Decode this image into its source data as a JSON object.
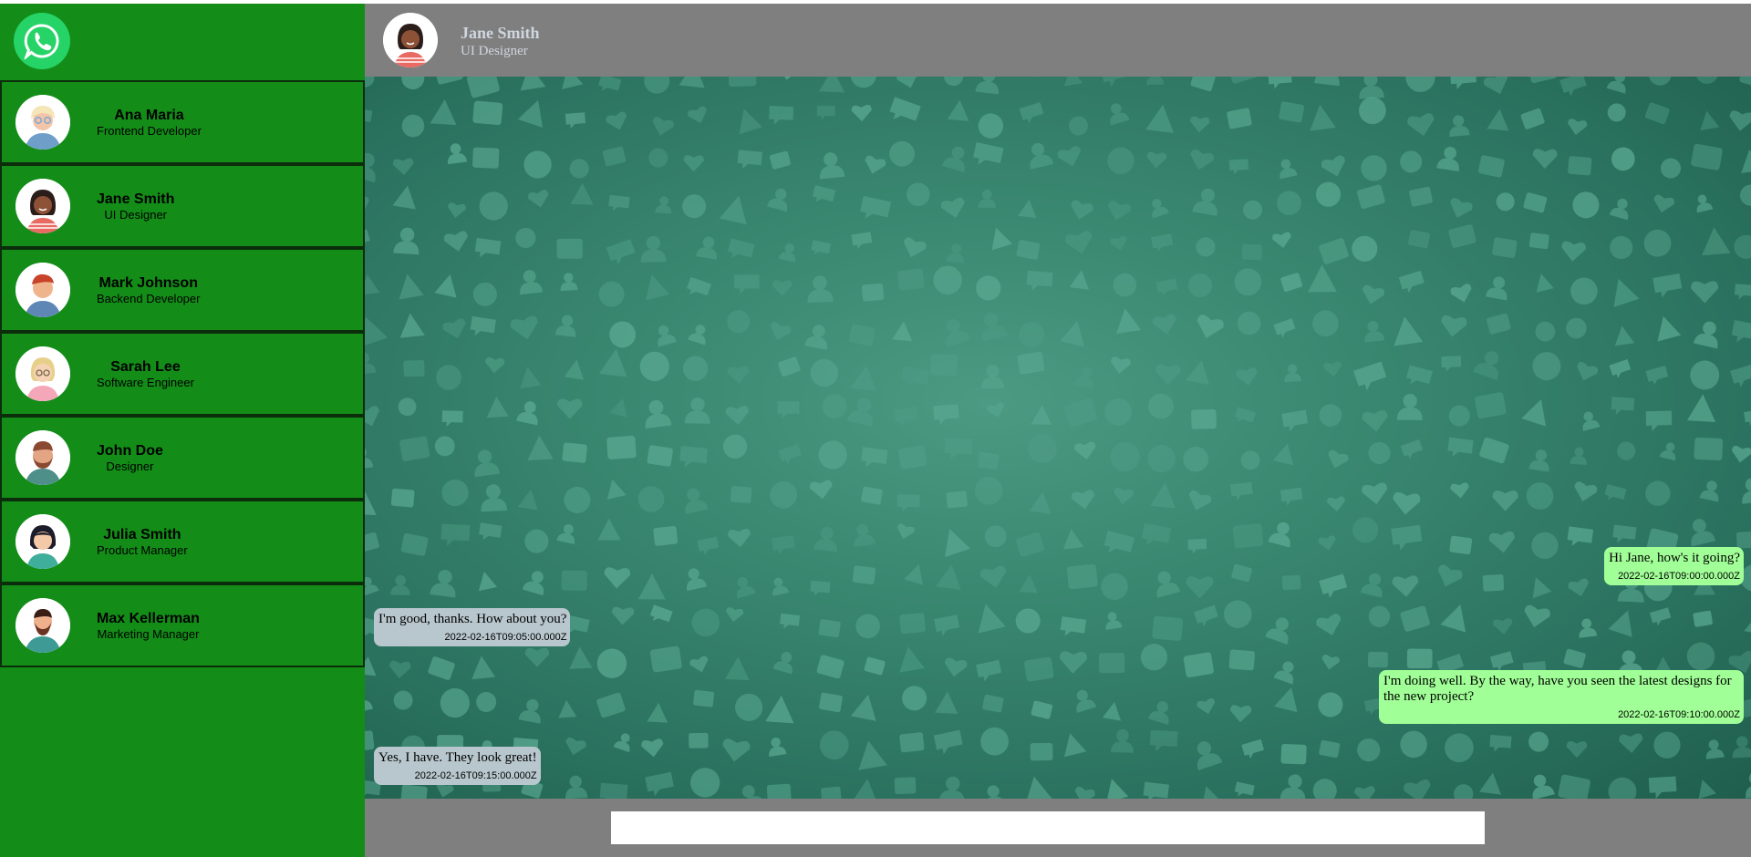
{
  "app": {
    "logo_icon": "whatsapp-icon",
    "colors": {
      "sidebar": "#138d18",
      "header": "#7f7f7f",
      "sent_bubble": "#a1ff97",
      "received_bubble": "#b8c7cd",
      "chat_background": "#2f7a66"
    }
  },
  "contacts": [
    {
      "name": "Ana Maria",
      "role": "Frontend Developer",
      "avatar_icon": "avatar-ana-maria-icon"
    },
    {
      "name": "Jane Smith",
      "role": "UI Designer",
      "avatar_icon": "avatar-jane-smith-icon"
    },
    {
      "name": "Mark Johnson",
      "role": "Backend Developer",
      "avatar_icon": "avatar-mark-johnson-icon"
    },
    {
      "name": "Sarah Lee",
      "role": "Software Engineer",
      "avatar_icon": "avatar-sarah-lee-icon"
    },
    {
      "name": "John Doe",
      "role": "Designer",
      "avatar_icon": "avatar-john-doe-icon"
    },
    {
      "name": "Julia Smith",
      "role": "Product Manager",
      "avatar_icon": "avatar-julia-smith-icon"
    },
    {
      "name": "Max Kellerman",
      "role": "Marketing Manager",
      "avatar_icon": "avatar-max-kellerman-icon"
    }
  ],
  "chat": {
    "name": "Jane Smith",
    "role": "UI Designer",
    "messages": [
      {
        "text": "Hi Jane, how's it going?",
        "time": "2022-02-16T09:00:00.000Z",
        "direction": "sent"
      },
      {
        "text": "I'm good, thanks. How about you?",
        "time": "2022-02-16T09:05:00.000Z",
        "direction": "received"
      },
      {
        "text": "I'm doing well. By the way, have you seen the latest designs for the new project?",
        "time": "2022-02-16T09:10:00.000Z",
        "direction": "sent"
      },
      {
        "text": "Yes, I have. They look great!",
        "time": "2022-02-16T09:15:00.000Z",
        "direction": "received"
      }
    ]
  },
  "composer": {
    "placeholder": "",
    "value": ""
  }
}
